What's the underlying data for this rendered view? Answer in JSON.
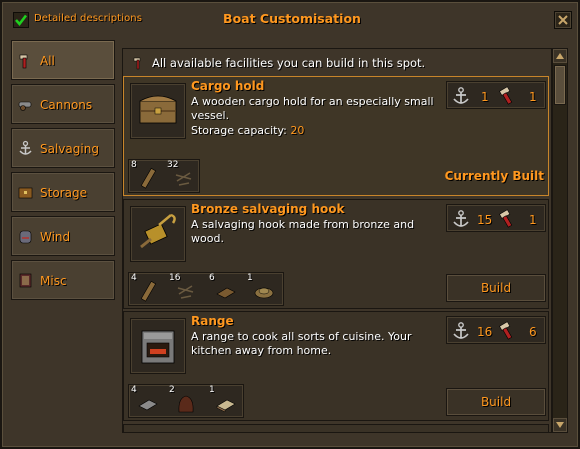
{
  "titlebar": {
    "checkbox_label": "Detailed descriptions",
    "title": "Boat Customisation"
  },
  "tabs": [
    {
      "label": "All",
      "icon": "hammer-icon",
      "active": true
    },
    {
      "label": "Cannons",
      "icon": "cannon-icon",
      "active": false
    },
    {
      "label": "Salvaging",
      "icon": "anchor-icon",
      "active": false
    },
    {
      "label": "Storage",
      "icon": "chest-icon",
      "active": false
    },
    {
      "label": "Wind",
      "icon": "wind-icon",
      "active": false
    },
    {
      "label": "Misc",
      "icon": "scroll-icon",
      "active": false
    }
  ],
  "hint": "All available facilities you can build in this spot.",
  "entries": [
    {
      "name": "Cargo hold",
      "description": "A wooden cargo hold for an especially small vessel.",
      "stat_label": "Storage capacity:",
      "stat_value": "20",
      "req_sailing": "1",
      "req_construction": "1",
      "materials": [
        {
          "qty": "8",
          "icon": "plank-icon"
        },
        {
          "qty": "32",
          "icon": "nails-icon"
        }
      ],
      "status": "Currently Built"
    },
    {
      "name": "Bronze salvaging hook",
      "description": "A salvaging hook made from bronze and wood.",
      "req_sailing": "15",
      "req_construction": "1",
      "materials": [
        {
          "qty": "4",
          "icon": "plank-icon"
        },
        {
          "qty": "16",
          "icon": "nails-icon"
        },
        {
          "qty": "6",
          "icon": "bronze-bar-icon"
        },
        {
          "qty": "1",
          "icon": "rope-icon"
        }
      ],
      "button": "Build"
    },
    {
      "name": "Range",
      "description": "A range to cook all sorts of cuisine. Your kitchen away from home.",
      "req_sailing": "16",
      "req_construction": "6",
      "materials": [
        {
          "qty": "4",
          "icon": "steel-bar-icon"
        },
        {
          "qty": "2",
          "icon": "clay-icon"
        },
        {
          "qty": "1",
          "icon": "book-icon"
        }
      ],
      "button": "Build"
    }
  ],
  "colors": {
    "accent": "#ff981f",
    "panel": "#3e3529",
    "built_border": "#c8852a"
  }
}
